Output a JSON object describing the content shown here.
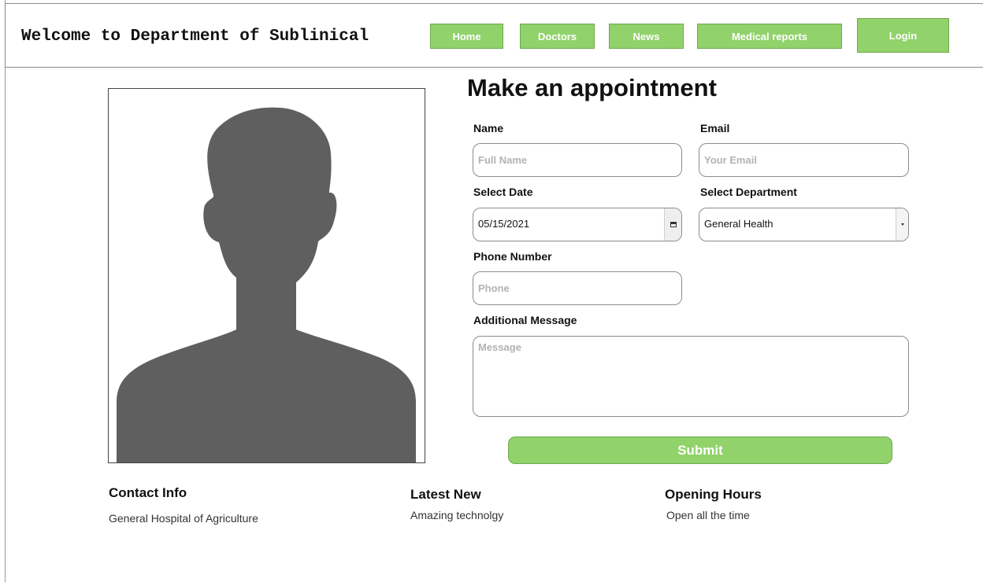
{
  "header": {
    "site_title": "Welcome to Department of Sublinical",
    "nav": {
      "home": "Home",
      "doctors": "Doctors",
      "news": "News",
      "medical_reports": "Medical reports",
      "login": "Login"
    }
  },
  "form": {
    "title": "Make an appointment",
    "name": {
      "label": "Name",
      "placeholder": "Full Name"
    },
    "email": {
      "label": "Email",
      "placeholder": "Your Email"
    },
    "date": {
      "label": "Select Date",
      "value": "05/15/2021",
      "icon": "calendar-icon"
    },
    "department": {
      "label": "Select Department",
      "selected": "General Health",
      "icon": "chevron-down-icon"
    },
    "phone": {
      "label": "Phone Number",
      "placeholder": "Phone"
    },
    "message": {
      "label": "Additional Message",
      "placeholder": "Message"
    },
    "submit_label": "Submit"
  },
  "photo": {
    "icon": "person-silhouette-icon"
  },
  "footer": {
    "contact": {
      "heading": "Contact Info",
      "text": "General Hospital of Agriculture"
    },
    "news": {
      "heading": "Latest New",
      "text": "Amazing technolgy"
    },
    "hours": {
      "heading": "Opening Hours",
      "text": "Open all the time"
    }
  },
  "colors": {
    "accent": "#91d26b",
    "silhouette": "#5f5f5f",
    "border": "#8c8c8c"
  }
}
